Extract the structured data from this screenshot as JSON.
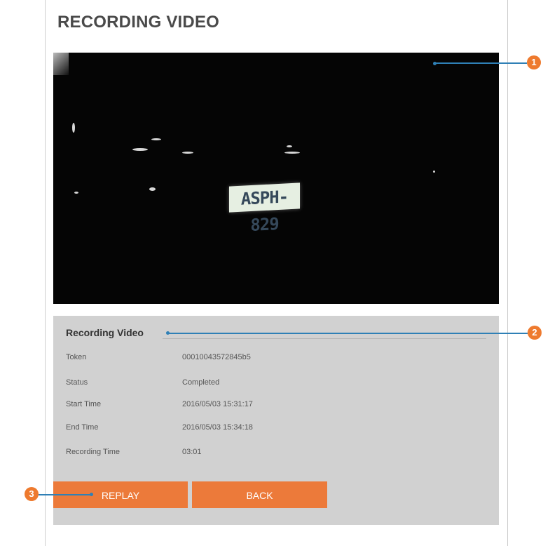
{
  "page": {
    "title": "RECORDING VIDEO"
  },
  "video": {
    "plate_text": "ASPH-829"
  },
  "info": {
    "title": "Recording Video",
    "rows": [
      {
        "label": "Token",
        "value": "00010043572845b5"
      },
      {
        "label": "Status",
        "value": "Completed"
      },
      {
        "label": "Start Time",
        "value": "2016/05/03 15:31:17"
      },
      {
        "label": "End Time",
        "value": "2016/05/03 15:34:18"
      },
      {
        "label": "Recording Time",
        "value": "03:01"
      }
    ]
  },
  "buttons": {
    "replay": "REPLAY",
    "back": "BACK"
  },
  "callouts": [
    "1",
    "2",
    "3"
  ],
  "colors": {
    "accent": "#ec7a3a",
    "callout": "#2f80b6",
    "panel": "#d1d1d1"
  }
}
